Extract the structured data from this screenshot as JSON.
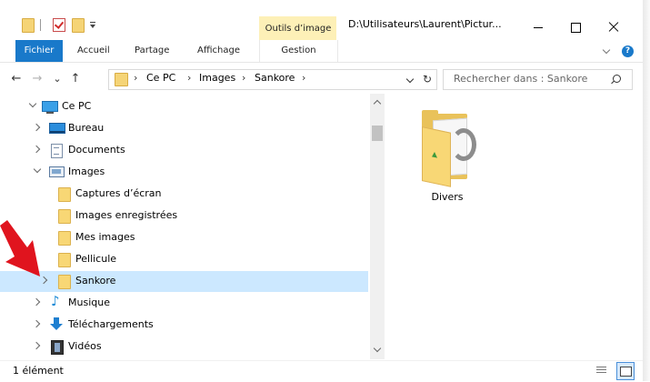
{
  "window": {
    "title": "D:\\Utilisateurs\\Laurent\\Pictur...",
    "contextual_group_label": "Outils d’image"
  },
  "ribbon": {
    "tabs": [
      {
        "label": "Fichier",
        "active": true
      },
      {
        "label": "Accueil"
      },
      {
        "label": "Partage"
      },
      {
        "label": "Affichage"
      },
      {
        "label": "Gestion"
      }
    ]
  },
  "address": {
    "crumbs": [
      "Ce PC",
      "Images",
      "Sankore"
    ],
    "separator": "›",
    "search_placeholder": "Rechercher dans : Sankore"
  },
  "nav_buttons": {
    "back": "←",
    "forward": "→",
    "recent": "⌄",
    "up": "↑",
    "refresh": "↻"
  },
  "tree": {
    "items": [
      {
        "label": "Ce PC",
        "icon": "computer-icon",
        "expanded": true
      },
      {
        "label": "Bureau",
        "icon": "desktop-icon"
      },
      {
        "label": "Documents",
        "icon": "documents-icon"
      },
      {
        "label": "Images",
        "icon": "images-icon",
        "expanded": true
      },
      {
        "label": "Captures d’écran",
        "icon": "folder-icon"
      },
      {
        "label": "Images enregistrées",
        "icon": "folder-icon"
      },
      {
        "label": "Mes images",
        "icon": "folder-icon"
      },
      {
        "label": "Pellicule",
        "icon": "folder-icon"
      },
      {
        "label": "Sankore",
        "icon": "folder-icon",
        "selected": true
      },
      {
        "label": "Musique",
        "icon": "music-icon"
      },
      {
        "label": "Téléchargements",
        "icon": "download-icon"
      },
      {
        "label": "Vidéos",
        "icon": "video-icon"
      }
    ]
  },
  "content": {
    "items": [
      {
        "label": "Divers",
        "icon": "folder-icon"
      }
    ]
  },
  "status": {
    "count_text": "1 élément"
  },
  "colors": {
    "accent": "#1979ca",
    "selection": "#cce8ff",
    "contextual_tab": "#fdf0b7",
    "annotation_arrow": "#e0141e"
  }
}
